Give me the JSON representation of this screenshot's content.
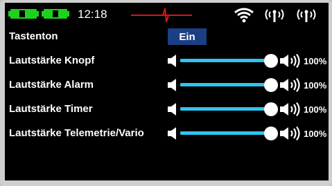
{
  "status": {
    "time": "12:18",
    "colors": {
      "battery": "#1fd11f",
      "signal": "#d31818",
      "wifi": "#ffffff"
    },
    "icons": [
      "battery-icon",
      "battery-icon",
      "signal-trace-icon",
      "wifi-icon",
      "antenna-icon",
      "antenna-icon"
    ]
  },
  "settings": {
    "key_tone": {
      "label": "Tastenton",
      "value": "Ein"
    },
    "volumes": [
      {
        "label": "Lautstärke Knopf",
        "value": "100%",
        "level": 1.0
      },
      {
        "label": "Lautstärke Alarm",
        "value": "100%",
        "level": 1.0
      },
      {
        "label": "Lautstärke Timer",
        "value": "100%",
        "level": 1.0
      },
      {
        "label": "Lautstärke Telemetrie/Vario",
        "value": "100%",
        "level": 1.0
      }
    ],
    "accent_color": "#2fc4f0",
    "button_color": "#1b3f84"
  }
}
